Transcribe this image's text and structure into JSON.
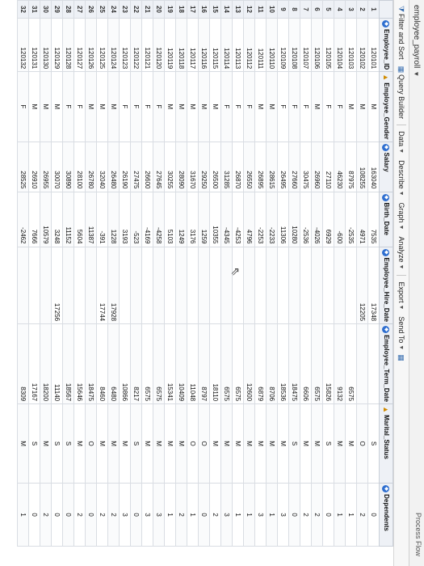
{
  "window": {
    "title": "employee_payroll",
    "process_flow": "Process Flow"
  },
  "toolbar": {
    "items": [
      "Filter and Sort",
      "Query Builder",
      "Data",
      "Describe",
      "Graph",
      "Analyze",
      "Export",
      "Send To"
    ]
  },
  "table": {
    "columns": [
      "Employee_ID",
      "Employee_Gender",
      "Salary",
      "Birth_Date",
      "Employee_Hire_Date",
      "Employee_Term_Date",
      "Marital_Status",
      "Dependents"
    ],
    "rows": [
      [
        "1",
        "120101",
        "M",
        "163040",
        "7535",
        "17348",
        "",
        "S",
        "0"
      ],
      [
        "2",
        "120102",
        "M",
        "108255",
        "4971",
        "12205",
        "",
        "O",
        "2"
      ],
      [
        "3",
        "120103",
        "M",
        "87975",
        "-2535",
        "",
        "6575",
        "M",
        "1"
      ],
      [
        "4",
        "120104",
        "F",
        "46230",
        "-600",
        "",
        "9132",
        "M",
        "1"
      ],
      [
        "5",
        "120105",
        "F",
        "27110",
        "6929",
        "",
        "15826",
        "S",
        "0"
      ],
      [
        "6",
        "120106",
        "M",
        "26960",
        "-4026",
        "",
        "6575",
        "M",
        "2"
      ],
      [
        "7",
        "120107",
        "F",
        "30475",
        "-2536",
        "",
        "6606",
        "M",
        "2"
      ],
      [
        "8",
        "120108",
        "F",
        "27660",
        "10280",
        "",
        "18475",
        "S",
        "0"
      ],
      [
        "9",
        "120109",
        "F",
        "26495",
        "11306",
        "",
        "18536",
        "M",
        "3"
      ],
      [
        "10",
        "120110",
        "M",
        "28615",
        "-2233",
        "",
        "8706",
        "M",
        "1"
      ],
      [
        "11",
        "120111",
        "M",
        "26895",
        "-2253",
        "",
        "6879",
        "M",
        "3"
      ],
      [
        "12",
        "120112",
        "F",
        "26550",
        "4796",
        "",
        "12600",
        "M",
        "1"
      ],
      [
        "13",
        "120113",
        "F",
        "26870",
        "-4253",
        "",
        "6575",
        "M",
        "1"
      ],
      [
        "14",
        "120114",
        "F",
        "31285",
        "-4345",
        "",
        "6575",
        "M",
        "3"
      ],
      [
        "15",
        "120115",
        "M",
        "26500",
        "10355",
        "",
        "18110",
        "M",
        "2"
      ],
      [
        "16",
        "120116",
        "M",
        "29250",
        "1259",
        "",
        "8797",
        "O",
        "0"
      ],
      [
        "17",
        "120117",
        "M",
        "31670",
        "3176",
        "",
        "11048",
        "O",
        "1"
      ],
      [
        "18",
        "120118",
        "M",
        "28090",
        "1249",
        "",
        "10409",
        "M",
        "2"
      ],
      [
        "19",
        "120119",
        "M",
        "30255",
        "5103",
        "",
        "15341",
        "M",
        "1"
      ],
      [
        "20",
        "120120",
        "F",
        "27645",
        "-4258",
        "",
        "6575",
        "M",
        "3"
      ],
      [
        "21",
        "120121",
        "F",
        "26600",
        "-4169",
        "",
        "6575",
        "M",
        "3"
      ],
      [
        "22",
        "120122",
        "F",
        "27475",
        "-523",
        "",
        "8217",
        "S",
        "0"
      ],
      [
        "23",
        "120123",
        "F",
        "26190",
        "3193",
        "",
        "10866",
        "M",
        "3"
      ],
      [
        "24",
        "120124",
        "M",
        "26480",
        "1228",
        "17928",
        "6480",
        "M",
        "2"
      ],
      [
        "25",
        "120125",
        "M",
        "32040",
        "-391",
        "17744",
        "8460",
        "M",
        "2"
      ],
      [
        "26",
        "120126",
        "M",
        "26780",
        "11387",
        "",
        "18475",
        "O",
        "0"
      ],
      [
        "27",
        "120127",
        "F",
        "28100",
        "5604",
        "",
        "15646",
        "M",
        "2"
      ],
      [
        "28",
        "120128",
        "F",
        "30890",
        "11152",
        "",
        "18567",
        "S",
        "0"
      ],
      [
        "29",
        "120129",
        "M",
        "30070",
        "3248",
        "17256",
        "11140",
        "S",
        "0"
      ],
      [
        "30",
        "120130",
        "M",
        "26955",
        "10579",
        "",
        "18200",
        "M",
        "2"
      ],
      [
        "31",
        "120131",
        "M",
        "26910",
        "7666",
        "",
        "17167",
        "S",
        "0"
      ],
      [
        "32",
        "120132",
        "F",
        "28525",
        "-2462",
        "",
        "8309",
        "M",
        "1"
      ]
    ]
  },
  "colors": {
    "header_bg": "#eef1f6",
    "icon_blue": "#2f6fd0",
    "icon_warn": "#d18b00"
  }
}
